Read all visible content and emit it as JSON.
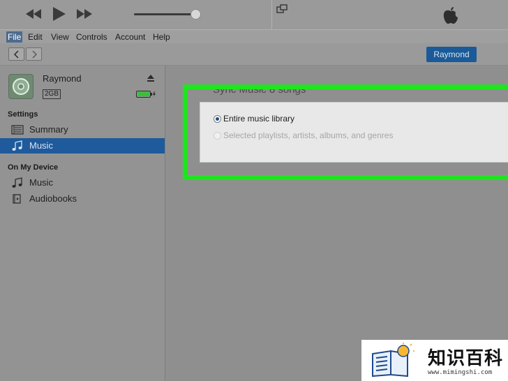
{
  "menu": {
    "file": "File",
    "edit": "Edit",
    "view": "View",
    "controls": "Controls",
    "account": "Account",
    "help": "Help"
  },
  "header": {
    "device_button": "Raymond"
  },
  "device": {
    "name": "Raymond",
    "capacity": "2GB"
  },
  "sidebar": {
    "settings_heading": "Settings",
    "settings_items": [
      {
        "label": "Summary",
        "icon": "summary-list-icon"
      },
      {
        "label": "Music",
        "icon": "music-note-icon",
        "selected": true
      }
    ],
    "on_device_heading": "On My Device",
    "device_items": [
      {
        "label": "Music",
        "icon": "music-note-icon"
      },
      {
        "label": "Audiobooks",
        "icon": "audiobook-icon"
      }
    ]
  },
  "main": {
    "sync_title": "Sync Music  8 songs",
    "options": [
      {
        "label": "Entire music library",
        "selected": true,
        "enabled": true
      },
      {
        "label": "Selected playlists, artists, albums, and genres",
        "selected": false,
        "enabled": false
      }
    ]
  },
  "colors": {
    "highlight": "#1ee61e",
    "selected": "#1e5a9c"
  },
  "watermark": {
    "title": "知识百科",
    "url": "www.mimingshi.com"
  }
}
